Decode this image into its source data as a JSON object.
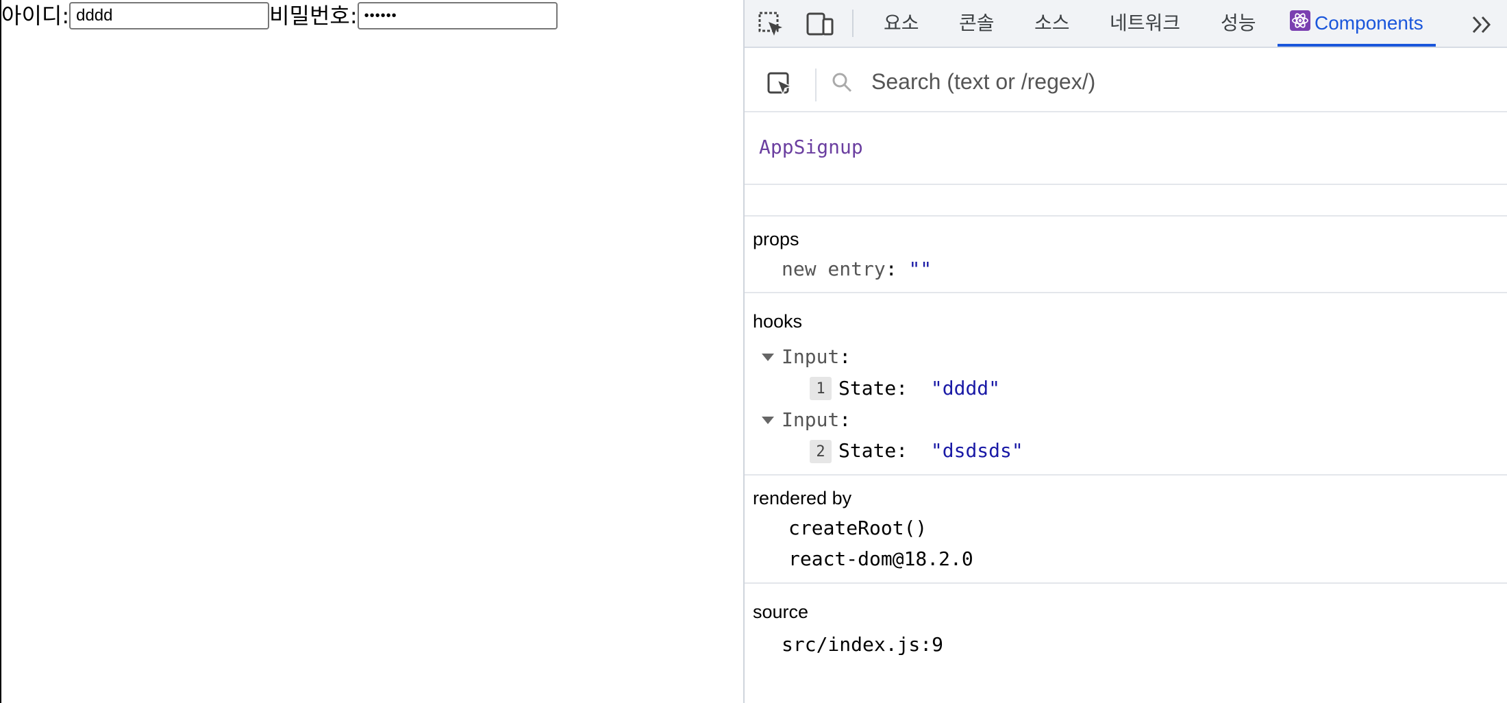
{
  "page": {
    "id_label": "아이디:",
    "id_value": "dddd",
    "pw_label": "비밀번호:",
    "pw_value": "••••••"
  },
  "devtools": {
    "tabs": [
      {
        "label": "요소"
      },
      {
        "label": "콘솔"
      },
      {
        "label": "소스"
      },
      {
        "label": "네트워크"
      },
      {
        "label": "성능"
      },
      {
        "label": "Components"
      }
    ],
    "search": {
      "placeholder": "Search (text or /regex/)"
    },
    "component_name": "AppSignup",
    "props": {
      "title": "props",
      "entry_key": "new entry",
      "entry_value": "\"\""
    },
    "hooks": {
      "title": "hooks",
      "items": [
        {
          "name": "Input",
          "index": "1",
          "state_label": "State:",
          "state_value": "\"dddd\""
        },
        {
          "name": "Input",
          "index": "2",
          "state_label": "State:",
          "state_value": "\"dsdsds\""
        }
      ]
    },
    "rendered_by": {
      "title": "rendered by",
      "items": [
        "createRoot()",
        "react-dom@18.2.0"
      ]
    },
    "source": {
      "title": "source",
      "value": "src/index.js:9"
    },
    "accent_color": "#1a56db"
  }
}
